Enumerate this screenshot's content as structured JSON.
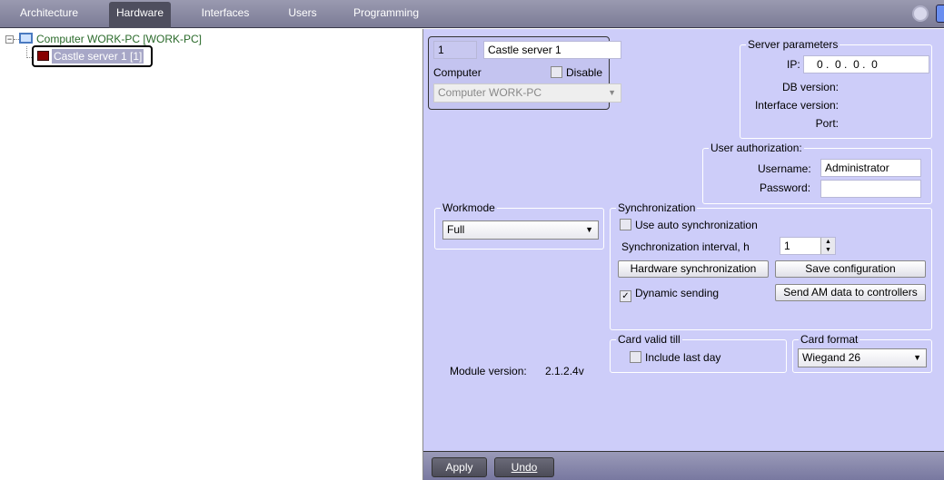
{
  "tabs": [
    "Architecture",
    "Hardware",
    "Interfaces",
    "Users",
    "Programming"
  ],
  "active_tab": "Hardware",
  "tree": {
    "computer": "Computer WORK-PC [WORK-PC]",
    "server": "Castle server 1 [1]"
  },
  "header": {
    "id": "1",
    "name": "Castle server 1",
    "computer_label": "Computer",
    "disable_label": "Disable",
    "computer_value": "Computer WORK-PC"
  },
  "server_params": {
    "title": "Server parameters",
    "ip_label": "IP:",
    "ip": [
      "0",
      "0",
      "0",
      "0"
    ],
    "db_version": "DB version:",
    "interface_version": "Interface version:",
    "port": "Port:"
  },
  "auth": {
    "title": "User authorization:",
    "username_label": "Username:",
    "username": "Administrator",
    "password_label": "Password:"
  },
  "workmode": {
    "title": "Workmode",
    "value": "Full"
  },
  "sync": {
    "title": "Synchronization",
    "auto": "Use auto synchronization",
    "interval_label": "Synchronization interval, h",
    "interval": "1",
    "hw_sync": "Hardware synchronization",
    "save_config": "Save configuration",
    "dynamic": "Dynamic sending",
    "send_am": "Send AM data to controllers"
  },
  "card_valid": {
    "title": "Card valid till",
    "include": "Include last day"
  },
  "card_format": {
    "title": "Card format",
    "value": "Wiegand 26"
  },
  "module": {
    "label": "Module version:",
    "value": "2.1.2.4v"
  },
  "footer": {
    "apply": "Apply",
    "undo": "Undo"
  }
}
